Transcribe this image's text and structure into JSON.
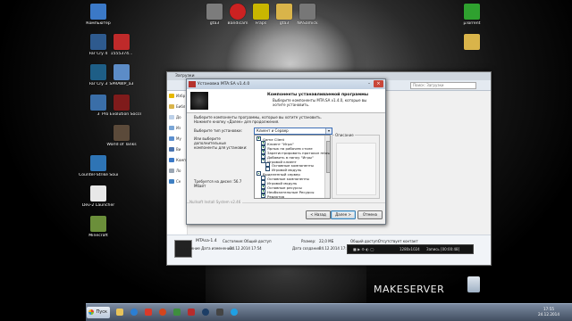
{
  "desktop": {
    "icons": [
      {
        "label": "Компьютер",
        "color": "#3b79c7"
      },
      {
        "label": "Far Cry 4",
        "color": "#2e5a8e"
      },
      {
        "label": "1555374...",
        "color": "#bf2a2a"
      },
      {
        "label": "Far Cry 3",
        "color": "#1e5e86"
      },
      {
        "label": "SPRAWP_a3",
        "color": "#5c8cc7"
      },
      {
        "label": "3",
        "color": "#3a6ea8"
      },
      {
        "label": "Pro Evolution Soccer 2014",
        "color": "#7f1b1b"
      },
      {
        "label": "World of Tanks",
        "color": "#5b4a3a"
      },
      {
        "label": "Counter-Strike Source v34",
        "color": "#2e74b5"
      },
      {
        "label": "Dev-2 Launcher",
        "color": "#e8e8e8"
      },
      {
        "label": "Minecraft",
        "color": "#6b8f3a"
      },
      {
        "label": "gta3",
        "color": "#7c7c7c"
      },
      {
        "label": "Bandicam",
        "color": "#cc2222"
      },
      {
        "label": "Fraps",
        "color": "#c9b600"
      },
      {
        "label": "gta3",
        "color": "#d9b44a"
      },
      {
        "label": "NASamick",
        "color": "#777777"
      },
      {
        "label": "µTorrent",
        "color": "#2fa12f"
      },
      {
        "label": "",
        "color": "#d9b44a"
      }
    ]
  },
  "explorer": {
    "title": "Загрузки",
    "search_placeholder": "Поиск: Загрузки",
    "nav_items": [
      "Избр",
      "Библ",
      "До",
      "Из",
      "Му",
      "Ви",
      "Компь",
      "Ло",
      "Се"
    ],
    "status": {
      "name": "MTAsa-1.4",
      "state_label": "Состояние:",
      "state_value": "Общий доступ",
      "size_label": "Размер:",
      "size_value": "22,0 МБ",
      "modified_label": "Приложение Дата изменения:",
      "modified_value": "24.12.2014 17:54",
      "created_label": "Дата создания:",
      "created_value": "24.12.2014 17:54",
      "access_label": "Общий доступ:",
      "access_value": "Отсутствует контакт"
    }
  },
  "wizard": {
    "title": "Установка MTA:SA v1.4.0",
    "header_title": "Компоненты устанавливаемой программы",
    "header_subtitle": "Выберите компоненты MTA:SA v1.4.0, которые вы хотите установить.",
    "intro": "Выберите компоненты программы, которые вы хотите установить. Нажмите кнопку «Далее» для продолжения.",
    "type_label": "Выберите тип установки:",
    "or_label": "Или выберите дополнительные компоненты для установки:",
    "space_label": "Требуется на диске: 56.7 Мбайт",
    "combo_value": "Клиент и Сервер",
    "tree": [
      {
        "label": "Game Client",
        "checked": true,
        "indent": 0
      },
      {
        "label": "Клиент \"Игра\"",
        "checked": true,
        "indent": 1
      },
      {
        "label": "Ярлык на рабочем столе",
        "checked": true,
        "indent": 1
      },
      {
        "label": "Зарегистрировать протокол mtasa://",
        "checked": true,
        "indent": 1
      },
      {
        "label": "Добавить в папку \"Игры\"",
        "checked": true,
        "indent": 1
      },
      {
        "label": "Игровой клиент",
        "checked": true,
        "indent": 1
      },
      {
        "label": "Основные компоненты",
        "checked": false,
        "indent": 2
      },
      {
        "label": "Игровой модуль",
        "checked": false,
        "indent": 2
      },
      {
        "label": "Выделенный сервер",
        "checked": true,
        "indent": 0
      },
      {
        "label": "Основные компоненты",
        "checked": false,
        "indent": 1
      },
      {
        "label": "Игровой модуль",
        "checked": false,
        "indent": 1
      },
      {
        "label": "Основные ресурсы",
        "checked": true,
        "indent": 1
      },
      {
        "label": "Необязательные Ресурсы",
        "checked": true,
        "indent": 1
      },
      {
        "label": "Редактор",
        "checked": true,
        "indent": 1
      }
    ],
    "description_title": "Описание",
    "brand": "Nullsoft Install System v2.46",
    "back_label": "< Назад",
    "next_label": "Далее >",
    "cancel_label": "Отмена"
  },
  "recorder": {
    "resolution": "1280x1024",
    "record_text": "Запись [00:00:48]"
  },
  "taskbar": {
    "start_label": "Пуск",
    "buttons": [
      {
        "name": "explorer",
        "color": "#e8c35a"
      },
      {
        "name": "browser",
        "color": "#2b7fd3"
      },
      {
        "name": "media",
        "color": "#d93a2a"
      },
      {
        "name": "bandicam",
        "color": "#d4451d"
      },
      {
        "name": "app",
        "color": "#3e8e3e"
      },
      {
        "name": "mta",
        "color": "#b82c2c"
      },
      {
        "name": "steam",
        "color": "#1d3e66"
      },
      {
        "name": "terminal",
        "color": "#444444"
      },
      {
        "name": "skype",
        "color": "#1fa0e3"
      }
    ],
    "clock_time": "17:55",
    "clock_date": "24.12.2014"
  },
  "watermark": {
    "text": "MAKE",
    "text2": "SERVER"
  }
}
